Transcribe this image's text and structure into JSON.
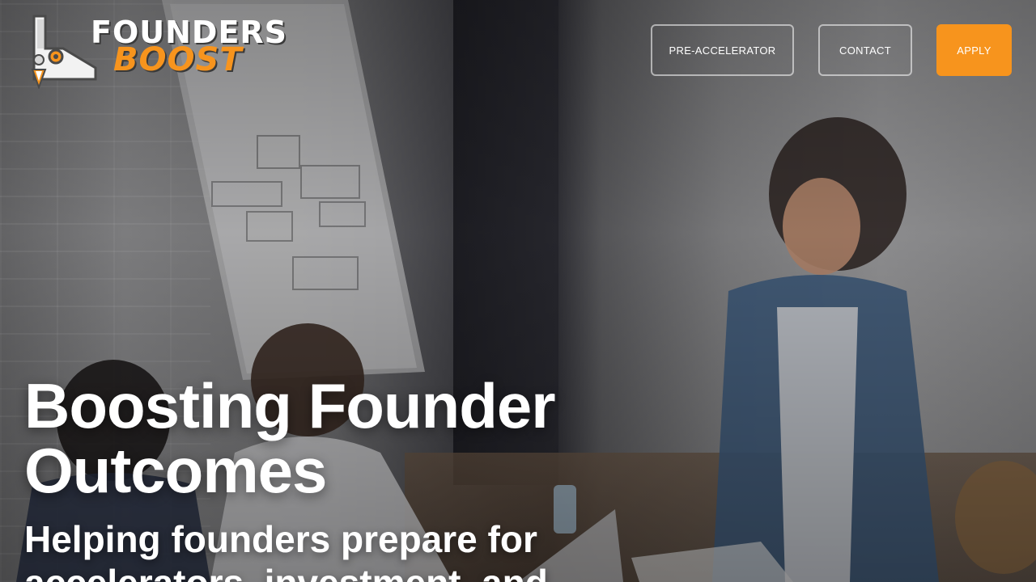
{
  "brand": {
    "name_line1": "FOUNDERS",
    "name_line2": "BOOST",
    "accent_color": "#f7941d"
  },
  "nav": {
    "items": [
      {
        "label": "PRE-ACCELERATOR"
      },
      {
        "label": "CONTACT"
      },
      {
        "label": "APPLY"
      }
    ]
  },
  "hero": {
    "title_line1": "Boosting Founder",
    "title_line2": "Outcomes",
    "subtitle_line1": "Helping founders prepare for",
    "subtitle_line2": "accelerators, investment, and"
  }
}
